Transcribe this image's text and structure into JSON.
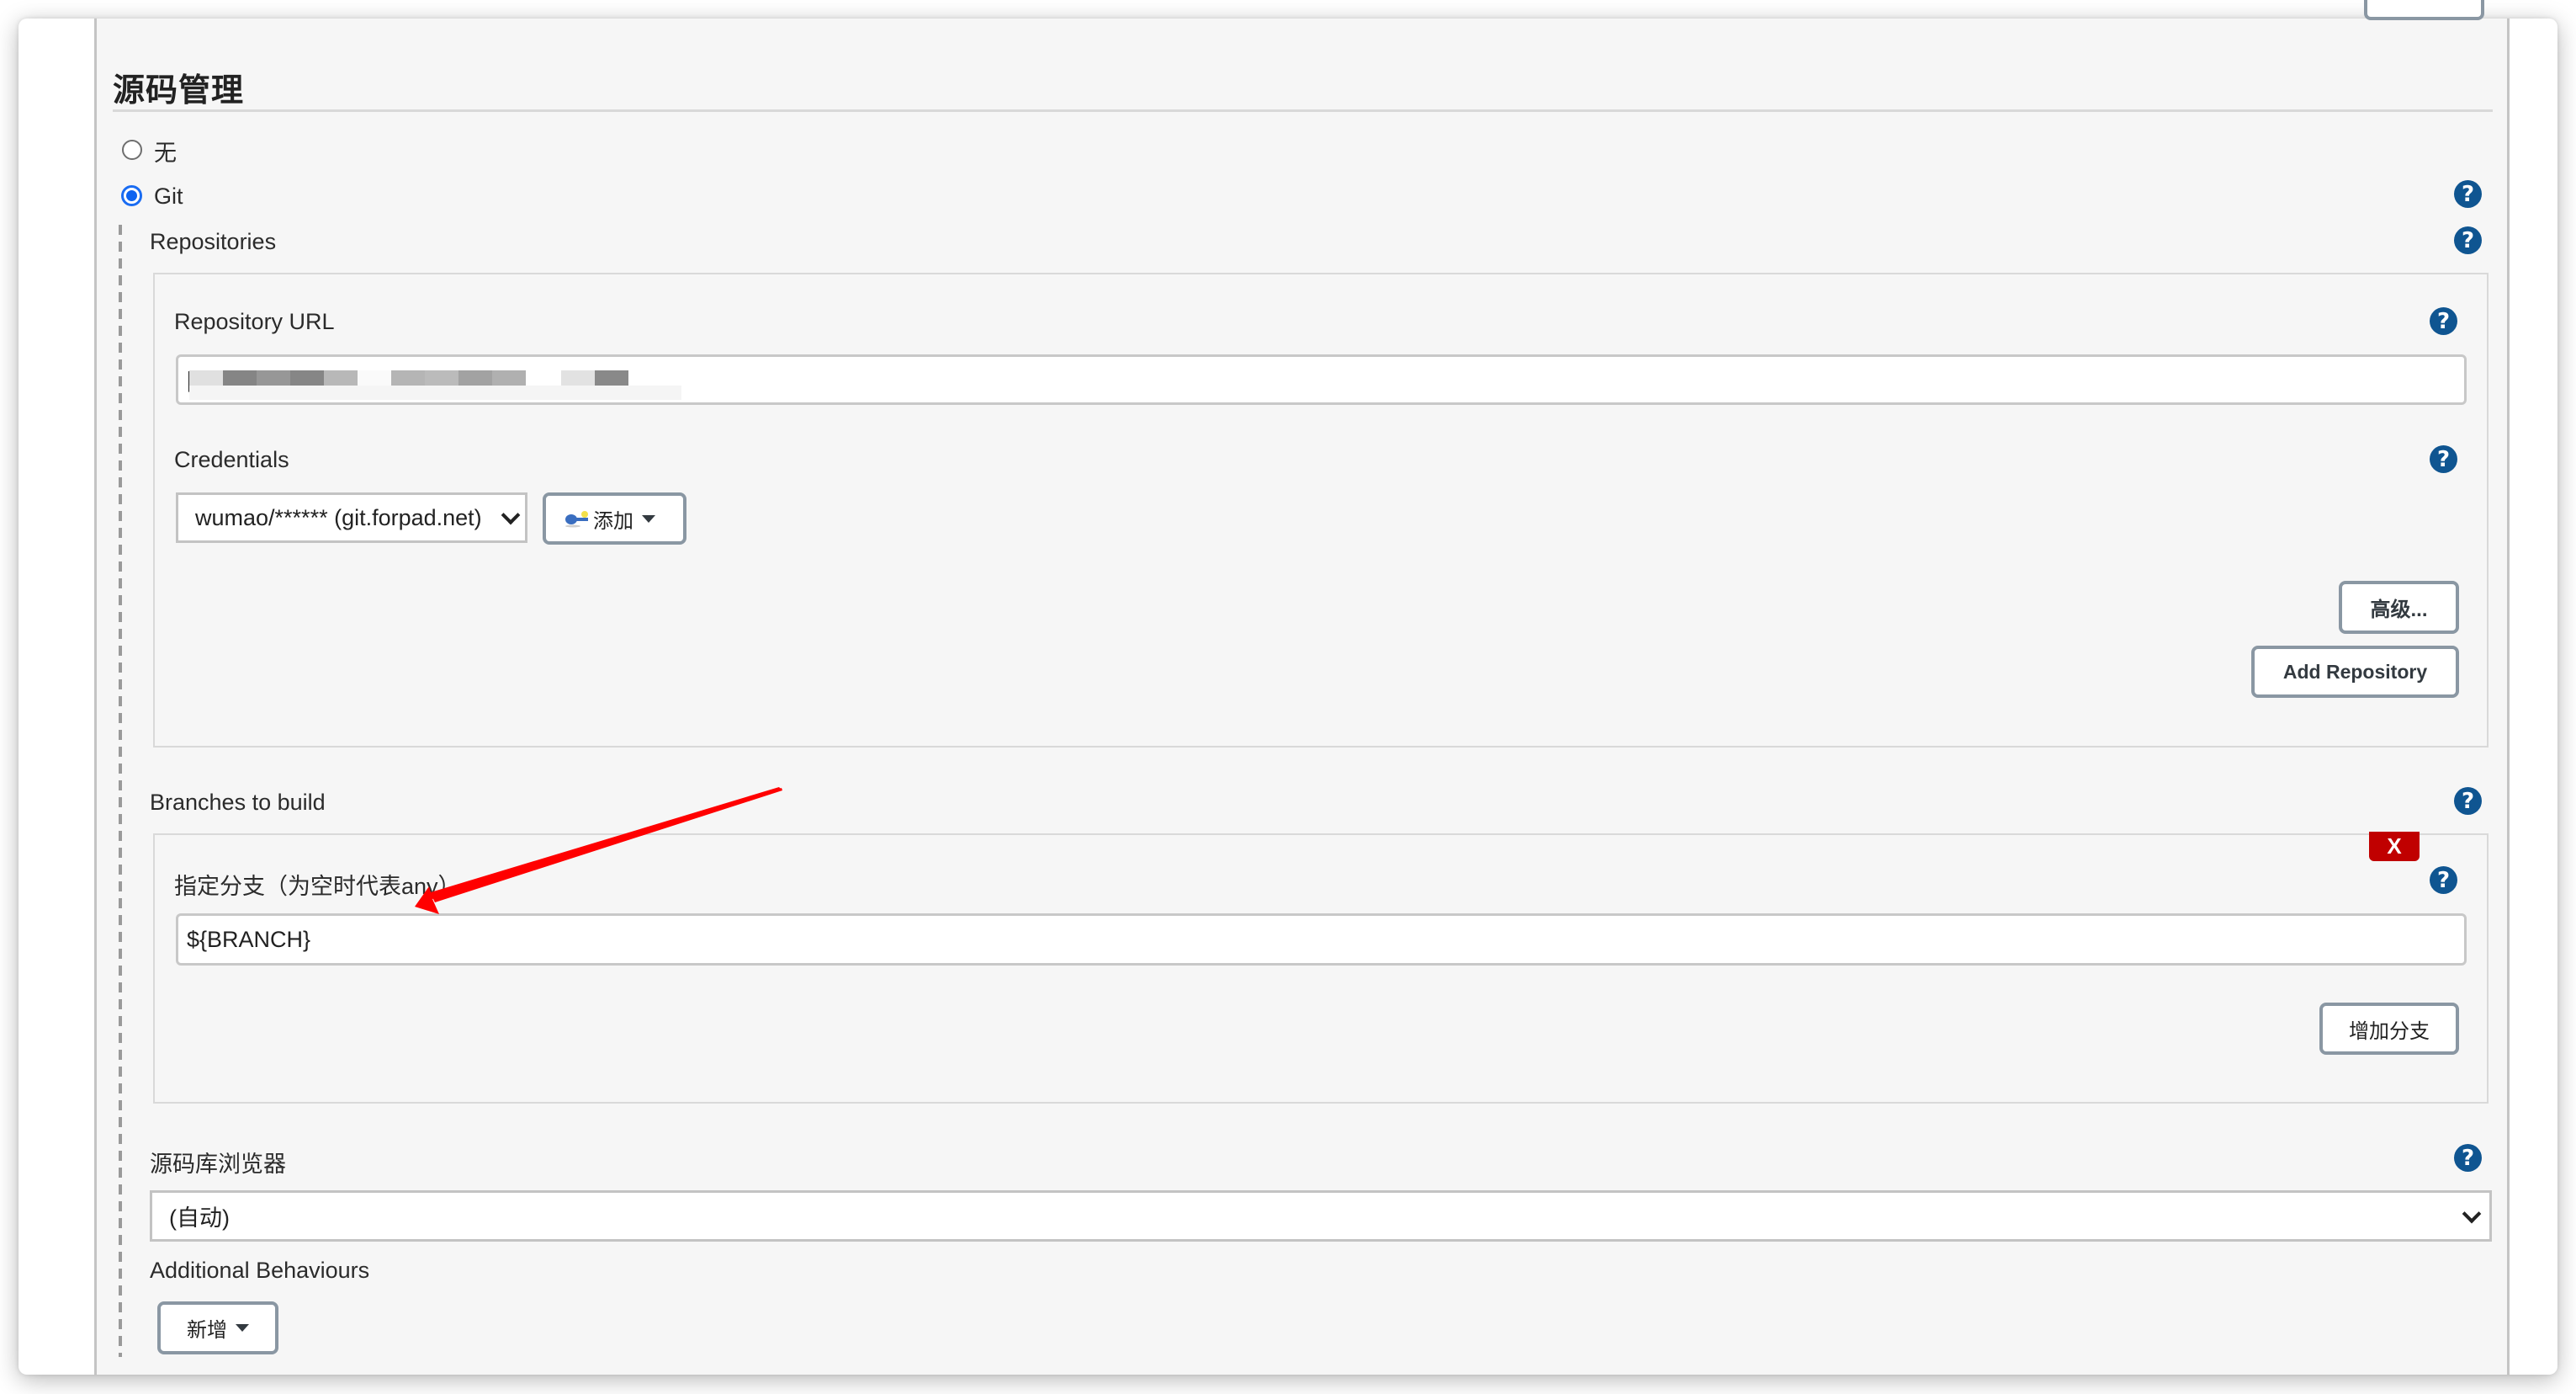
{
  "section": {
    "title": "源码管理",
    "top_partial_button": ""
  },
  "scm_options": [
    {
      "label": "无",
      "checked": false
    },
    {
      "label": "Git",
      "checked": true
    }
  ],
  "repositories": {
    "heading": "Repositories",
    "url_label": "Repository URL",
    "url_value_redacted": true,
    "url_cursor_char": "|",
    "credentials_label": "Credentials",
    "credentials_selected": "wumao/****** (git.forpad.net)",
    "add_credentials_button": "添加",
    "add_credentials_icon": "key-icon",
    "advanced_button": "高级...",
    "add_repository_button": "Add Repository"
  },
  "branches": {
    "heading": "Branches to build",
    "delete_button": "X",
    "branch_label": "指定分支（为空时代表any）",
    "branch_value": "${BRANCH}",
    "add_branch_button": "增加分支"
  },
  "repo_browser": {
    "label": "源码库浏览器",
    "selected": "(自动)"
  },
  "additional_behaviours": {
    "label": "Additional Behaviours",
    "add_button": "新增"
  },
  "help_icon_glyph": "?",
  "colors": {
    "help_icon": "#0f5591",
    "radio_checked": "#0d63f0",
    "delete_button": "#c00000",
    "annotation_arrow": "#ff0000",
    "button_border": "#8a97a3",
    "panel_background": "#f6f6f6"
  },
  "annotation": {
    "type": "arrow",
    "points_to": "branch_label"
  }
}
